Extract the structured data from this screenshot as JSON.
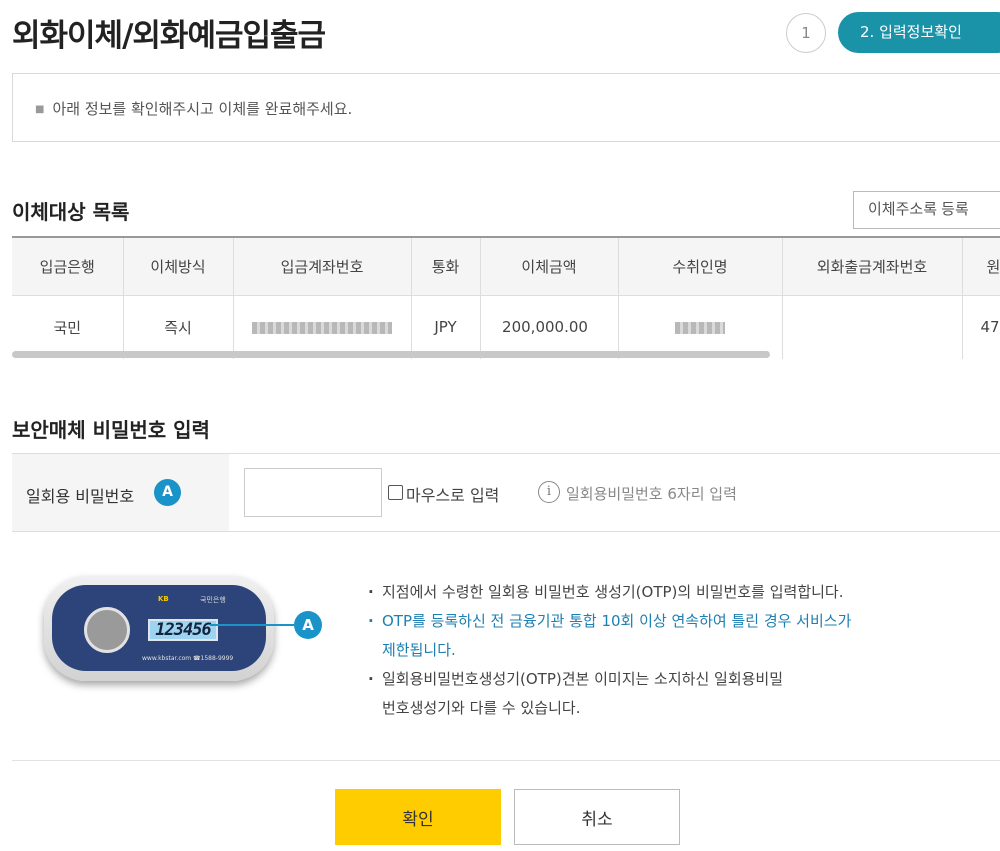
{
  "page": {
    "title": "외화이체/외화예금입출금"
  },
  "steps": {
    "step1_label": "1",
    "step2_label": "2. 입력정보확인"
  },
  "notice": {
    "text": "아래 정보를 확인해주시고 이체를 완료해주세요."
  },
  "transfer_list": {
    "title": "이체대상 목록",
    "register_button": "이체주소록 등록",
    "columns": [
      "입금은행",
      "이체방식",
      "입금계좌번호",
      "통화",
      "이체금액",
      "수취인명",
      "외화출금계좌번호",
      "원"
    ],
    "rows": [
      {
        "bank": "국민",
        "method": "즉시",
        "account": "[blurred]",
        "currency": "JPY",
        "amount": "200,000.00",
        "recipient": "[blurred]",
        "withdraw_account": "",
        "extra": "47"
      }
    ]
  },
  "security": {
    "title": "보안매체 비밀번호 입력",
    "otp_label": "일회용 비밀번호",
    "badge": "A",
    "input_value": "",
    "mouse_input_label": "마우스로 입력",
    "hint": "일회용비밀번호 6자리 입력"
  },
  "device": {
    "display": "123456",
    "badge": "A",
    "logo_left": "KB",
    "logo_right": "국민은행",
    "url": "www.kbstar.com  ☎1588-9999"
  },
  "guide": {
    "items": [
      "지점에서 수령한 일회용 비밀번호 생성기(OTP)의 비밀번호를 입력합니다.",
      "OTP를 등록하신 전 금융기관 통합 10회 이상 연속하여 틀린 경우 서비스가 제한됩니다.",
      "일회용비밀번호생성기(OTP)견본 이미지는 소지하신 일회용비밀번호생성기와 다를 수 있습니다."
    ]
  },
  "buttons": {
    "confirm": "확인",
    "cancel": "취소"
  },
  "colors": {
    "accent": "#1a93a9",
    "confirm": "#ffcc00",
    "badge": "#1a93c8",
    "warning_text": "#1d7fb3"
  },
  "icons": {
    "info": "info-circle-icon",
    "checkbox": "checkbox-icon"
  }
}
